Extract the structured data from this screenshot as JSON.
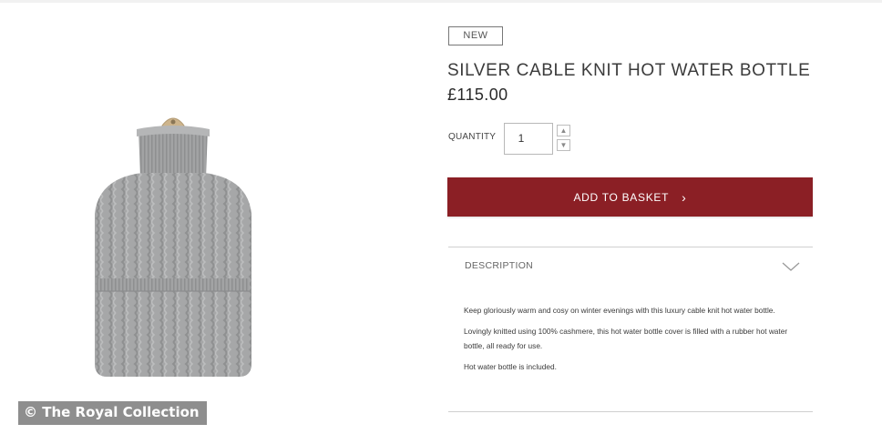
{
  "credit": "© The Royal Collection",
  "product": {
    "badge": "NEW",
    "title": "SILVER CABLE KNIT HOT WATER BOTTLE",
    "price": "£115.00",
    "image_icon": "knit-hot-water-bottle"
  },
  "quantity": {
    "label": "QUANTITY",
    "value": "1",
    "up_icon": "chevron-up-icon",
    "down_icon": "chevron-down-icon"
  },
  "basket": {
    "label": "ADD TO BASKET",
    "chevron": "›"
  },
  "description": {
    "header": "DESCRIPTION",
    "paragraphs": [
      "Keep gloriously warm and cosy on winter evenings with this luxury cable knit hot water bottle.",
      "Lovingly knitted using 100% cashmere, this hot water bottle cover is filled with a rubber hot water bottle, all ready for use.",
      "Hot water bottle is included."
    ]
  },
  "colors": {
    "button": "#8b1f25",
    "knit": "#a9aaab",
    "stopper": "#cdb48c"
  }
}
